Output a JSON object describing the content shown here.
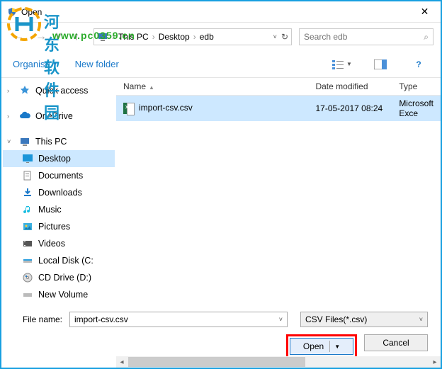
{
  "window": {
    "title": "Open"
  },
  "watermark": {
    "line1": "河东软件园",
    "line2": "www.pc0359.cn"
  },
  "breadcrumb": {
    "parts": [
      "This PC",
      "Desktop",
      "edb"
    ]
  },
  "search": {
    "placeholder": "Search edb"
  },
  "toolbar": {
    "organise": "Organise",
    "newfolder": "New folder"
  },
  "tree": {
    "quick": "Quick access",
    "onedrive": "OneDrive",
    "thispc": "This PC",
    "desktop": "Desktop",
    "documents": "Documents",
    "downloads": "Downloads",
    "music": "Music",
    "pictures": "Pictures",
    "videos": "Videos",
    "localc": "Local Disk (C:",
    "cddrive": "CD Drive (D:)",
    "newvol": "New Volume"
  },
  "columns": {
    "name": "Name",
    "date": "Date modified",
    "type": "Type"
  },
  "files": [
    {
      "name": "import-csv.csv",
      "date": "17-05-2017 08:24",
      "type": "Microsoft Exce"
    }
  ],
  "footer": {
    "filename_label": "File name:",
    "filename_value": "import-csv.csv",
    "filter": "CSV Files(*.csv)",
    "open": "Open",
    "cancel": "Cancel"
  }
}
